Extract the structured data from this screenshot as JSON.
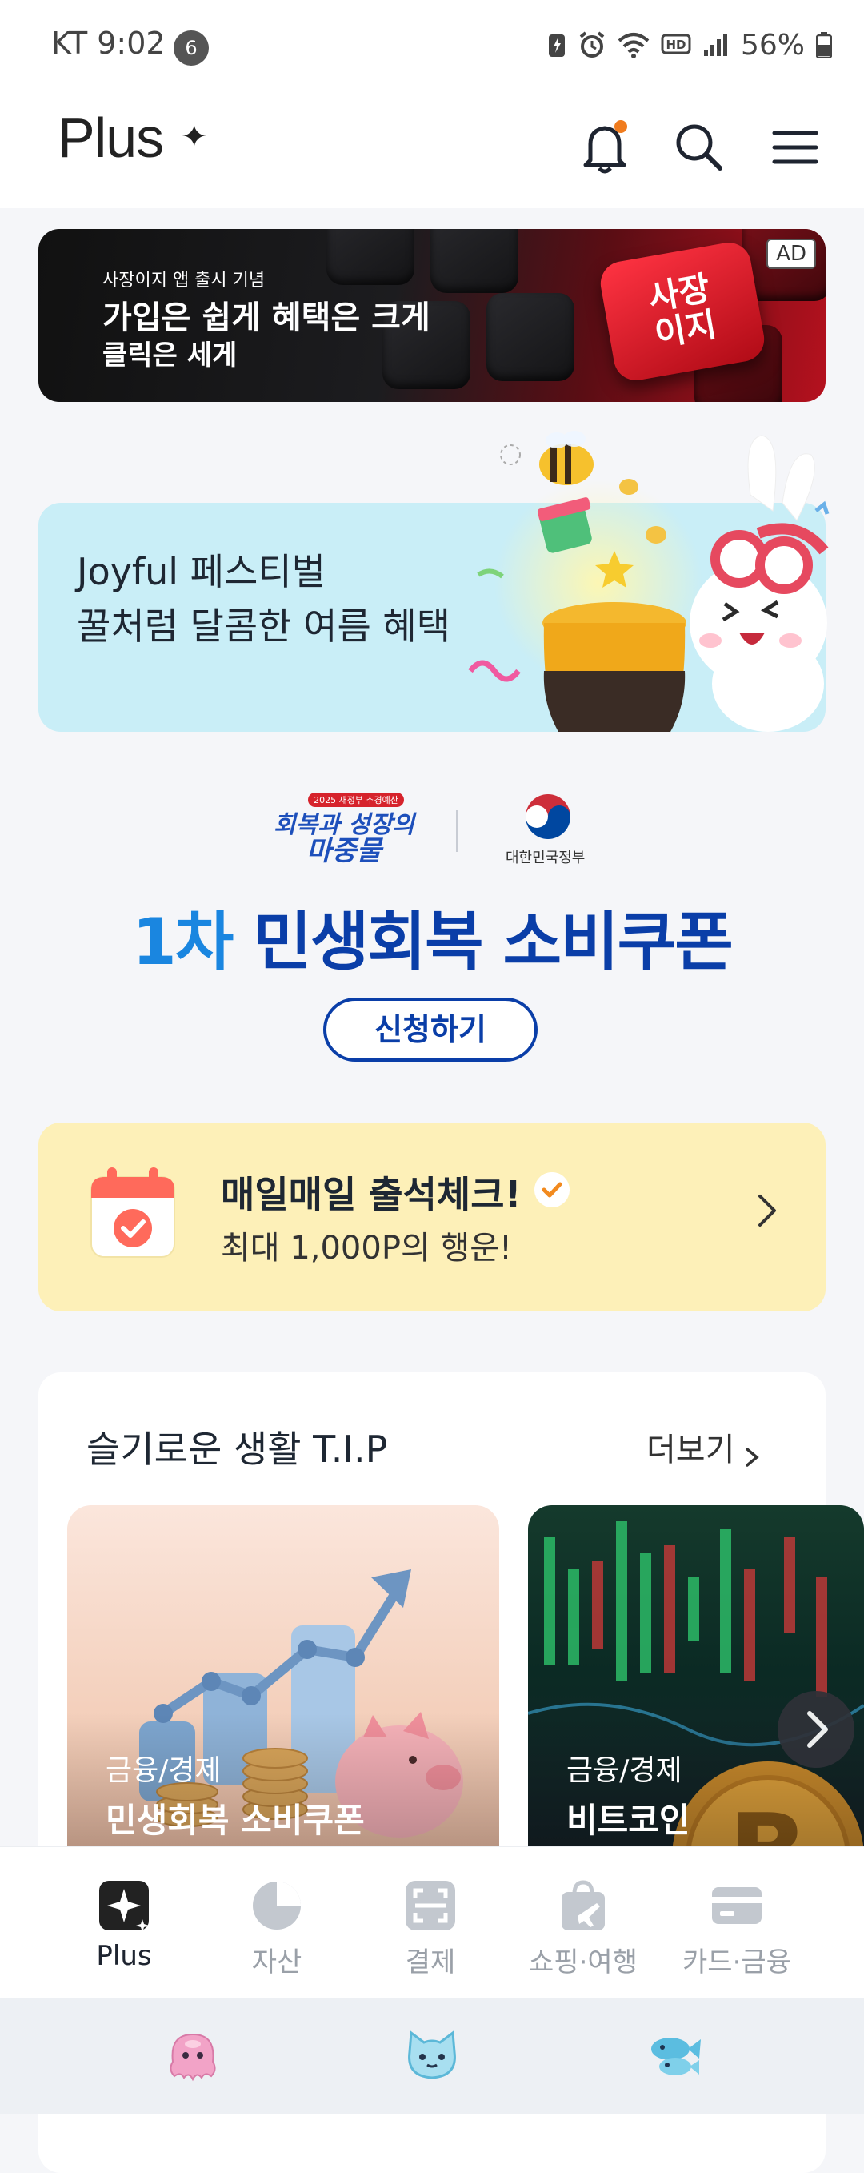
{
  "status_bar": {
    "carrier_time": "KT 9:02",
    "notification_count": "6",
    "battery": "56%"
  },
  "header": {
    "logo": "Plus",
    "logo_mark": "✦",
    "icons": [
      "bell-icon",
      "search-icon",
      "menu-icon"
    ],
    "notification_dot_color": "#f07c1e"
  },
  "ad_banner": {
    "badge": "AD",
    "small_text": "사장이지 앱 출시 기념",
    "title": "가입은 쉽게 혜택은 크게",
    "subtitle": "클릭은 세게",
    "logo_text": "사장\n이지"
  },
  "joyful_banner": {
    "line1": "Joyful 페스티벌",
    "line2": "꿀처럼 달콤한 여름 혜택"
  },
  "coupon": {
    "brand_year": "2025 새정부 추경예산",
    "brand": "회복과 성장의\n마중물",
    "gov": "대한민국정부",
    "title_accent": "1차",
    "title_rest": " 민생회복 소비쿠폰",
    "button": "신청하기"
  },
  "attendance": {
    "title": "매일매일 출석체크!",
    "subtitle": "최대 1,000P의 행운!"
  },
  "tips": {
    "title": "슬기로운 생활 T.I.P",
    "more": "더보기",
    "cards": [
      {
        "category": "금융/경제",
        "name": "민생회복 소비쿠폰"
      },
      {
        "category": "금융/경제",
        "name": "비트코인"
      }
    ]
  },
  "bottom_nav": [
    {
      "label": "Plus",
      "icon": "plus-sparkle-icon",
      "active": true
    },
    {
      "label": "자산",
      "icon": "pie-chart-icon",
      "active": false
    },
    {
      "label": "결제",
      "icon": "scan-pay-icon",
      "active": false
    },
    {
      "label": "쇼핑·여행",
      "icon": "shopping-bag-icon",
      "active": false
    },
    {
      "label": "카드·금융",
      "icon": "card-icon",
      "active": false
    }
  ],
  "system_nav": [
    "octopus-icon",
    "cat-face-icon",
    "fish-icon"
  ],
  "colors": {
    "coupon_navy": "#0a3ea8",
    "coupon_accent": "#1a86e0",
    "attendance_bg": "#fdf0b8",
    "joy_bg": "#c9eef7"
  }
}
